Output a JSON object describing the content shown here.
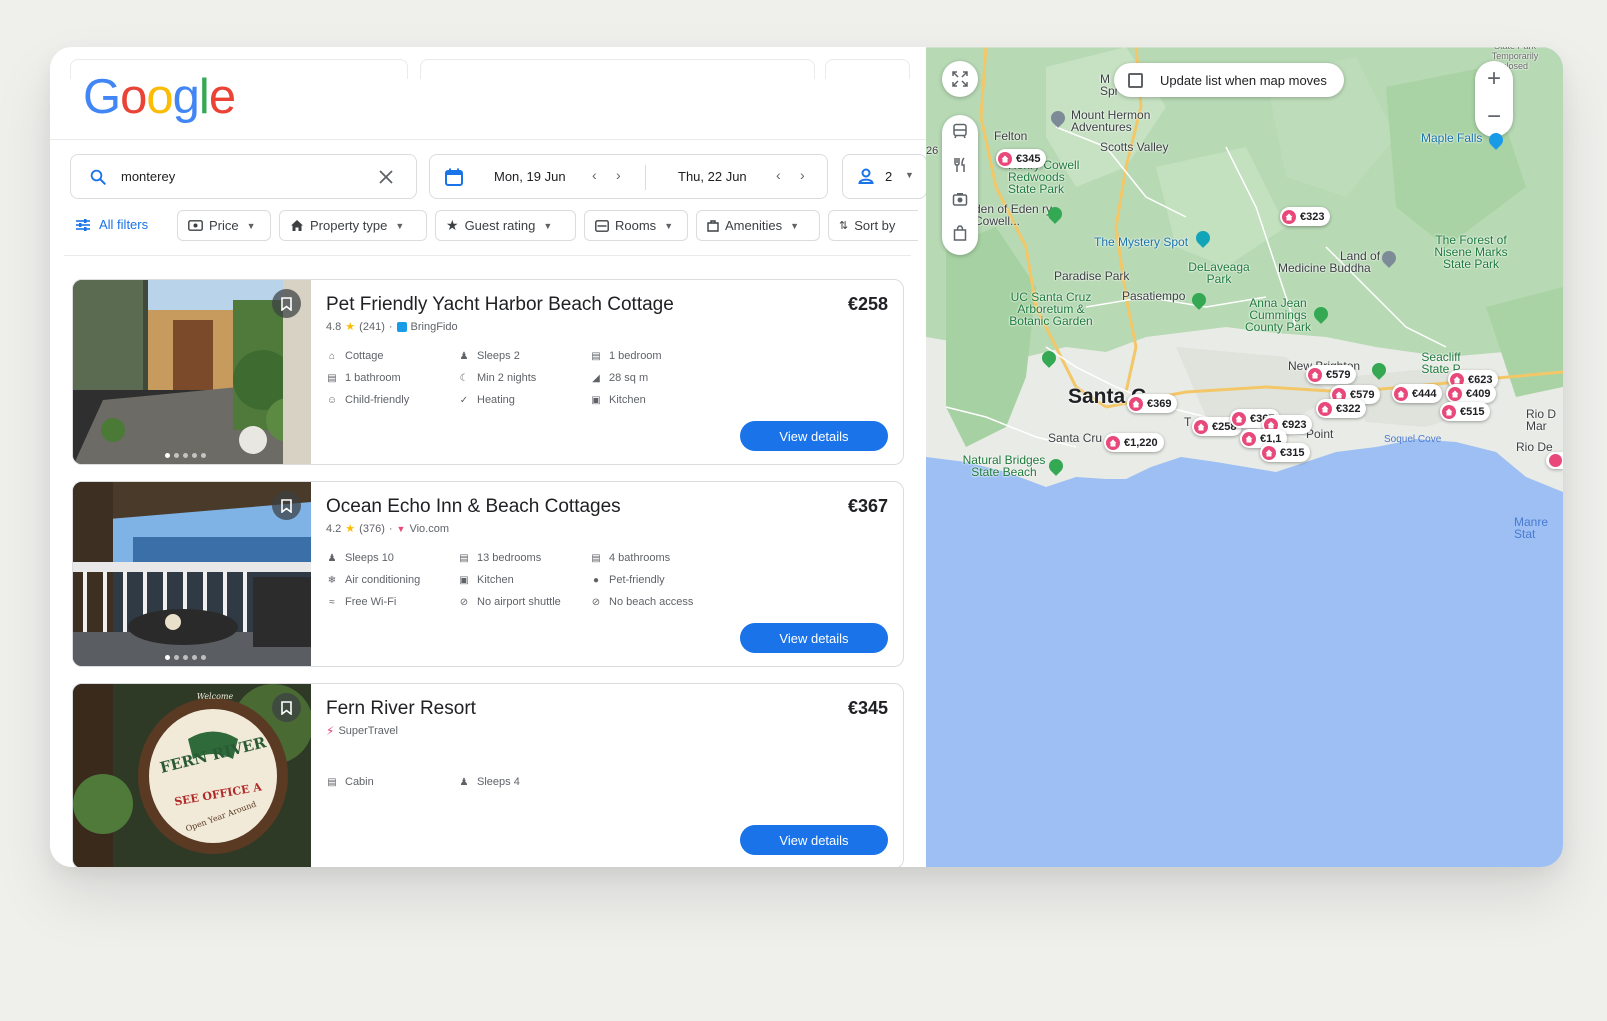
{
  "logo": {
    "letters": [
      "G",
      "o",
      "o",
      "g",
      "l",
      "e"
    ],
    "colors": [
      "#4285F4",
      "#EA4335",
      "#FBBC05",
      "#4285F4",
      "#34A853",
      "#EA4335"
    ]
  },
  "search": {
    "query": "monterey"
  },
  "dates": {
    "checkin": "Mon, 19 Jun",
    "checkout": "Thu, 22 Jun"
  },
  "guests": {
    "count": "2"
  },
  "filters": {
    "all_filters": "All filters",
    "chips": [
      "Price",
      "Property type",
      "Guest rating",
      "Rooms",
      "Amenities",
      "Sort by"
    ]
  },
  "listings": [
    {
      "title": "Pet Friendly Yacht Harbor Beach Cottage",
      "price": "€258",
      "rating": "4.8",
      "reviews": "(241)",
      "source": "BringFido",
      "amenities": [
        "Cottage",
        "Sleeps 2",
        "1 bedroom",
        "1 bathroom",
        "Min 2 nights",
        "28 sq m",
        "Child-friendly",
        "Heating",
        "Kitchen"
      ],
      "button": "View details"
    },
    {
      "title": "Ocean Echo Inn & Beach Cottages",
      "price": "€367",
      "rating": "4.2",
      "reviews": "(376)",
      "source": "Vio.com",
      "amenities": [
        "Sleeps 10",
        "13 bedrooms",
        "4 bathrooms",
        "Air conditioning",
        "Kitchen",
        "Pet-friendly",
        "Free Wi-Fi",
        "No airport shuttle",
        "No beach access"
      ],
      "button": "View details"
    },
    {
      "title": "Fern River Resort",
      "price": "€345",
      "source": "SuperTravel",
      "amenities": [
        "Cabin",
        "Sleeps 4"
      ],
      "button": "View details",
      "sign_text": [
        "FERN RIVER",
        "SEE OFFICE A",
        "Open Year Around",
        "Welcome"
      ]
    }
  ],
  "map": {
    "update_checkbox_label": "Update list when map moves",
    "zoom_in": "+",
    "zoom_out": "−",
    "edge_number": "26",
    "labels": {
      "felton": "Felton",
      "scotts_valley": "Scotts Valley",
      "mount_hermon": "Mount Hermon Adventures",
      "henry_cowell": "Henry Cowell Redwoods State Park",
      "garden_eden": "den of Eden ry Cowell...",
      "mystery_spot": "The Mystery Spot",
      "paradise_park": "Paradise Park",
      "delaveaga": "DeLaveaga Park",
      "medicine_buddha": "Medicine Buddha",
      "land_of": "Land of",
      "forest_nisene": "The Forest of Nisene Marks State Park",
      "maple_falls": "Maple Falls",
      "temporarily_closed": "State Park Temporarily closed",
      "ucsc_arboretum": "UC Santa Cruz Arboretum & Botanic Garden",
      "pasatiempo": "Pasatiempo",
      "anna_jean": "Anna Jean Cummings County Park",
      "santa_cruz": "Santa C",
      "santa_cruz_small": "Santa Cru",
      "natural_bridges": "Natural Bridges State Beach",
      "new_brighton": "New Brighton",
      "seacliff": "Seacliff State P",
      "soquel_cove": "Soquel Cove",
      "rio_del_mar": "Rio D Mar",
      "rio_de": "Rio De",
      "manresa": "Manre Stat",
      "point": "Point",
      "mt": "M Spr",
      "t": "T"
    },
    "markers": [
      "€345",
      "€323",
      "€369",
      "€1,220",
      "€258",
      "€367",
      "€923",
      "€1,1",
      "€315",
      "€579",
      "€579",
      "€322",
      "€444",
      "€623",
      "€409",
      "€515"
    ]
  }
}
